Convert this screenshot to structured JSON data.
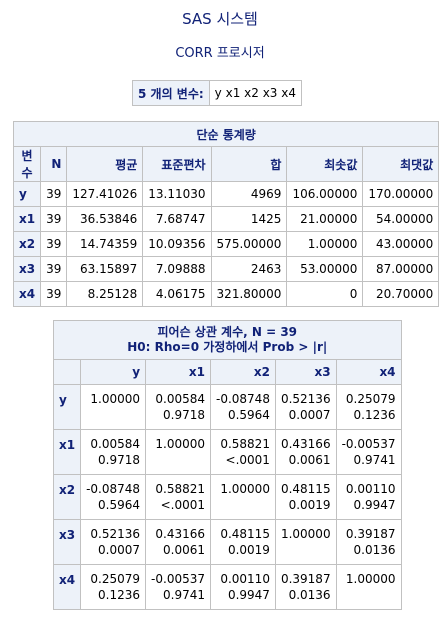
{
  "page": {
    "title": "SAS 시스템",
    "procedure": "CORR 프로시저"
  },
  "variables": {
    "label": "5 개의 변수:",
    "list": "y x1 x2 x3 x4"
  },
  "simple_stats": {
    "title": "단순 통계량",
    "headers": [
      "변수",
      "N",
      "평균",
      "표준편차",
      "합",
      "최솟값",
      "최댓값"
    ],
    "rows": [
      [
        "y",
        "39",
        "127.41026",
        "13.11030",
        "4969",
        "106.00000",
        "170.00000"
      ],
      [
        "x1",
        "39",
        "36.53846",
        "7.68747",
        "1425",
        "21.00000",
        "54.00000"
      ],
      [
        "x2",
        "39",
        "14.74359",
        "10.09356",
        "575.00000",
        "1.00000",
        "43.00000"
      ],
      [
        "x3",
        "39",
        "63.15897",
        "7.09888",
        "2463",
        "53.00000",
        "87.00000"
      ],
      [
        "x4",
        "39",
        "8.25128",
        "4.06175",
        "321.80000",
        "0",
        "20.70000"
      ]
    ]
  },
  "correlation": {
    "title_line1": "피어슨 상관 계수, N = 39",
    "title_line2": "H0: Rho=0 가정하에서 Prob > |r|",
    "columns": [
      "y",
      "x1",
      "x2",
      "x3",
      "x4"
    ],
    "rows": [
      {
        "name": "y",
        "cells": [
          [
            "1.00000",
            ""
          ],
          [
            "0.00584",
            "0.9718"
          ],
          [
            "-0.08748",
            "0.5964"
          ],
          [
            "0.52136",
            "0.0007"
          ],
          [
            "0.25079",
            "0.1236"
          ]
        ]
      },
      {
        "name": "x1",
        "cells": [
          [
            "0.00584",
            "0.9718"
          ],
          [
            "1.00000",
            ""
          ],
          [
            "0.58821",
            "<.0001"
          ],
          [
            "0.43166",
            "0.0061"
          ],
          [
            "-0.00537",
            "0.9741"
          ]
        ]
      },
      {
        "name": "x2",
        "cells": [
          [
            "-0.08748",
            "0.5964"
          ],
          [
            "0.58821",
            "<.0001"
          ],
          [
            "1.00000",
            ""
          ],
          [
            "0.48115",
            "0.0019"
          ],
          [
            "0.00110",
            "0.9947"
          ]
        ]
      },
      {
        "name": "x3",
        "cells": [
          [
            "0.52136",
            "0.0007"
          ],
          [
            "0.43166",
            "0.0061"
          ],
          [
            "0.48115",
            "0.0019"
          ],
          [
            "1.00000",
            ""
          ],
          [
            "0.39187",
            "0.0136"
          ]
        ]
      },
      {
        "name": "x4",
        "cells": [
          [
            "0.25079",
            "0.1236"
          ],
          [
            "-0.00537",
            "0.9741"
          ],
          [
            "0.00110",
            "0.9947"
          ],
          [
            "0.39187",
            "0.0136"
          ],
          [
            "1.00000",
            ""
          ]
        ]
      }
    ]
  }
}
